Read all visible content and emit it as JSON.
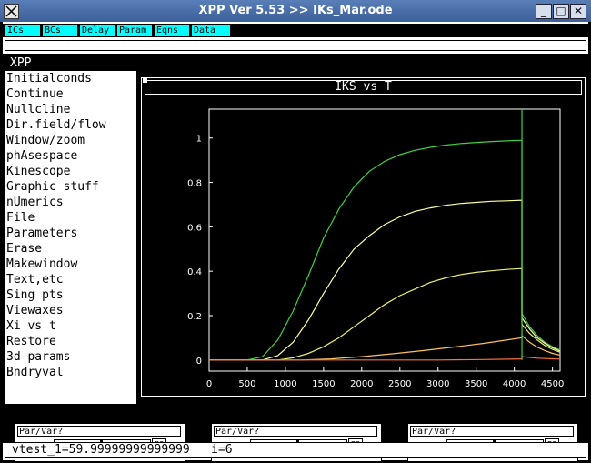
{
  "window": {
    "title": "XPP Ver 5.53 >> IKs_Mar.ode",
    "controls": [
      "_",
      "□",
      "✕"
    ]
  },
  "toolbar": [
    "ICs",
    "BCs",
    "Delay",
    "Param",
    "Eqns",
    "Data"
  ],
  "menu": {
    "title": "XPP",
    "items": [
      "Initialconds",
      "Continue",
      "Nullcline",
      "Dir.field/flow",
      "Window/zoom",
      "phAsespace",
      "Kinescope",
      "Graphic stuff",
      "nUmerics",
      "File",
      "Parameters",
      "Erase",
      "Makewindow",
      "Text,etc",
      "Sing pts",
      "Viewaxes",
      "Xi vs t",
      "Restore",
      "3d-params",
      "Bndryval"
    ]
  },
  "graph": {
    "header": "IKS vs T"
  },
  "chart_data": {
    "type": "line",
    "title": "",
    "xlabel": "",
    "ylabel": "",
    "xlim": [
      0,
      4600
    ],
    "ylim": [
      -0.05,
      1.13
    ],
    "xticks": [
      0,
      500,
      1000,
      1500,
      2000,
      2500,
      3000,
      3500,
      4000,
      4500
    ],
    "yticks": [
      0,
      0.2,
      0.4,
      0.6,
      0.8,
      1
    ],
    "ytick_labels": [
      "0",
      "0.2",
      "0.4",
      "0.6",
      "0.8",
      "1"
    ],
    "grid": false,
    "step_time": 4100,
    "series": [
      {
        "color": "#40d040",
        "x": [
          0,
          500,
          700,
          900,
          1100,
          1300,
          1500,
          1700,
          1900,
          2100,
          2300,
          2500,
          2700,
          2900,
          3100,
          3300,
          3500,
          3700,
          3900,
          4100,
          4100,
          4200,
          4300,
          4400,
          4500,
          4600
        ],
        "values": [
          0,
          0,
          0.015,
          0.09,
          0.22,
          0.38,
          0.55,
          0.68,
          0.78,
          0.85,
          0.895,
          0.925,
          0.945,
          0.958,
          0.968,
          0.975,
          0.98,
          0.984,
          0.987,
          0.99,
          0.21,
          0.15,
          0.11,
          0.08,
          0.06,
          0.045
        ]
      },
      {
        "color": "#ffffa0",
        "x": [
          0,
          700,
          900,
          1100,
          1300,
          1500,
          1700,
          1900,
          2100,
          2300,
          2500,
          2700,
          2900,
          3100,
          3300,
          3500,
          3700,
          3900,
          4100,
          4100,
          4200,
          4300,
          4400,
          4500,
          4600
        ],
        "values": [
          0,
          0,
          0.02,
          0.08,
          0.18,
          0.3,
          0.41,
          0.5,
          0.56,
          0.61,
          0.645,
          0.67,
          0.685,
          0.697,
          0.705,
          0.71,
          0.715,
          0.717,
          0.72,
          0.19,
          0.14,
          0.1,
          0.075,
          0.055,
          0.04
        ]
      },
      {
        "color": "#f0f070",
        "x": [
          0,
          900,
          1100,
          1300,
          1500,
          1700,
          1900,
          2100,
          2300,
          2500,
          2700,
          2900,
          3100,
          3300,
          3500,
          3700,
          3900,
          4100,
          4100,
          4200,
          4300,
          4400,
          4500,
          4600
        ],
        "values": [
          0,
          0,
          0.01,
          0.03,
          0.06,
          0.1,
          0.15,
          0.2,
          0.25,
          0.29,
          0.32,
          0.35,
          0.37,
          0.385,
          0.395,
          0.402,
          0.408,
          0.412,
          0.16,
          0.12,
          0.09,
          0.065,
          0.048,
          0.035
        ]
      },
      {
        "color": "#ffc060",
        "x": [
          0,
          1200,
          1600,
          2000,
          2400,
          2800,
          3200,
          3600,
          4100,
          4100,
          4200,
          4300,
          4400,
          4500,
          4600
        ],
        "values": [
          0,
          0,
          0.005,
          0.015,
          0.028,
          0.042,
          0.058,
          0.075,
          0.1,
          0.11,
          0.08,
          0.058,
          0.042,
          0.03,
          0.022
        ]
      },
      {
        "color": "#ff7040",
        "x": [
          0,
          3000,
          3600,
          4100,
          4100,
          4300,
          4600
        ],
        "values": [
          0,
          0,
          0.002,
          0.005,
          0.015,
          0.008,
          0.004
        ]
      }
    ],
    "spike": {
      "color": "#40d040",
      "x": 4100,
      "y": 1.13
    }
  },
  "sliders": [
    {
      "label": "Par/Var?",
      "go": "go"
    },
    {
      "label": "Par/Var?",
      "go": "go"
    },
    {
      "label": "Par/Var?",
      "go": "go"
    }
  ],
  "status": "vtest_1=59.99999999999999   i=6"
}
